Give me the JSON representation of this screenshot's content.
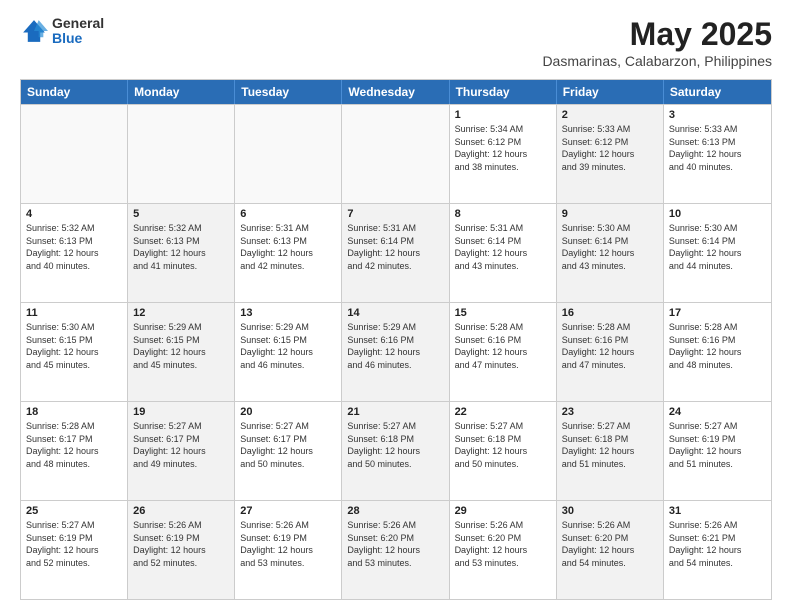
{
  "header": {
    "logo_general": "General",
    "logo_blue": "Blue",
    "month_year": "May 2025",
    "location": "Dasmarinas, Calabarzon, Philippines"
  },
  "weekdays": [
    "Sunday",
    "Monday",
    "Tuesday",
    "Wednesday",
    "Thursday",
    "Friday",
    "Saturday"
  ],
  "weeks": [
    [
      {
        "day": "",
        "info": "",
        "shaded": false,
        "empty": true
      },
      {
        "day": "",
        "info": "",
        "shaded": false,
        "empty": true
      },
      {
        "day": "",
        "info": "",
        "shaded": false,
        "empty": true
      },
      {
        "day": "",
        "info": "",
        "shaded": false,
        "empty": true
      },
      {
        "day": "1",
        "info": "Sunrise: 5:34 AM\nSunset: 6:12 PM\nDaylight: 12 hours\nand 38 minutes.",
        "shaded": false,
        "empty": false
      },
      {
        "day": "2",
        "info": "Sunrise: 5:33 AM\nSunset: 6:12 PM\nDaylight: 12 hours\nand 39 minutes.",
        "shaded": true,
        "empty": false
      },
      {
        "day": "3",
        "info": "Sunrise: 5:33 AM\nSunset: 6:13 PM\nDaylight: 12 hours\nand 40 minutes.",
        "shaded": false,
        "empty": false
      }
    ],
    [
      {
        "day": "4",
        "info": "Sunrise: 5:32 AM\nSunset: 6:13 PM\nDaylight: 12 hours\nand 40 minutes.",
        "shaded": false,
        "empty": false
      },
      {
        "day": "5",
        "info": "Sunrise: 5:32 AM\nSunset: 6:13 PM\nDaylight: 12 hours\nand 41 minutes.",
        "shaded": true,
        "empty": false
      },
      {
        "day": "6",
        "info": "Sunrise: 5:31 AM\nSunset: 6:13 PM\nDaylight: 12 hours\nand 42 minutes.",
        "shaded": false,
        "empty": false
      },
      {
        "day": "7",
        "info": "Sunrise: 5:31 AM\nSunset: 6:14 PM\nDaylight: 12 hours\nand 42 minutes.",
        "shaded": true,
        "empty": false
      },
      {
        "day": "8",
        "info": "Sunrise: 5:31 AM\nSunset: 6:14 PM\nDaylight: 12 hours\nand 43 minutes.",
        "shaded": false,
        "empty": false
      },
      {
        "day": "9",
        "info": "Sunrise: 5:30 AM\nSunset: 6:14 PM\nDaylight: 12 hours\nand 43 minutes.",
        "shaded": true,
        "empty": false
      },
      {
        "day": "10",
        "info": "Sunrise: 5:30 AM\nSunset: 6:14 PM\nDaylight: 12 hours\nand 44 minutes.",
        "shaded": false,
        "empty": false
      }
    ],
    [
      {
        "day": "11",
        "info": "Sunrise: 5:30 AM\nSunset: 6:15 PM\nDaylight: 12 hours\nand 45 minutes.",
        "shaded": false,
        "empty": false
      },
      {
        "day": "12",
        "info": "Sunrise: 5:29 AM\nSunset: 6:15 PM\nDaylight: 12 hours\nand 45 minutes.",
        "shaded": true,
        "empty": false
      },
      {
        "day": "13",
        "info": "Sunrise: 5:29 AM\nSunset: 6:15 PM\nDaylight: 12 hours\nand 46 minutes.",
        "shaded": false,
        "empty": false
      },
      {
        "day": "14",
        "info": "Sunrise: 5:29 AM\nSunset: 6:16 PM\nDaylight: 12 hours\nand 46 minutes.",
        "shaded": true,
        "empty": false
      },
      {
        "day": "15",
        "info": "Sunrise: 5:28 AM\nSunset: 6:16 PM\nDaylight: 12 hours\nand 47 minutes.",
        "shaded": false,
        "empty": false
      },
      {
        "day": "16",
        "info": "Sunrise: 5:28 AM\nSunset: 6:16 PM\nDaylight: 12 hours\nand 47 minutes.",
        "shaded": true,
        "empty": false
      },
      {
        "day": "17",
        "info": "Sunrise: 5:28 AM\nSunset: 6:16 PM\nDaylight: 12 hours\nand 48 minutes.",
        "shaded": false,
        "empty": false
      }
    ],
    [
      {
        "day": "18",
        "info": "Sunrise: 5:28 AM\nSunset: 6:17 PM\nDaylight: 12 hours\nand 48 minutes.",
        "shaded": false,
        "empty": false
      },
      {
        "day": "19",
        "info": "Sunrise: 5:27 AM\nSunset: 6:17 PM\nDaylight: 12 hours\nand 49 minutes.",
        "shaded": true,
        "empty": false
      },
      {
        "day": "20",
        "info": "Sunrise: 5:27 AM\nSunset: 6:17 PM\nDaylight: 12 hours\nand 50 minutes.",
        "shaded": false,
        "empty": false
      },
      {
        "day": "21",
        "info": "Sunrise: 5:27 AM\nSunset: 6:18 PM\nDaylight: 12 hours\nand 50 minutes.",
        "shaded": true,
        "empty": false
      },
      {
        "day": "22",
        "info": "Sunrise: 5:27 AM\nSunset: 6:18 PM\nDaylight: 12 hours\nand 50 minutes.",
        "shaded": false,
        "empty": false
      },
      {
        "day": "23",
        "info": "Sunrise: 5:27 AM\nSunset: 6:18 PM\nDaylight: 12 hours\nand 51 minutes.",
        "shaded": true,
        "empty": false
      },
      {
        "day": "24",
        "info": "Sunrise: 5:27 AM\nSunset: 6:19 PM\nDaylight: 12 hours\nand 51 minutes.",
        "shaded": false,
        "empty": false
      }
    ],
    [
      {
        "day": "25",
        "info": "Sunrise: 5:27 AM\nSunset: 6:19 PM\nDaylight: 12 hours\nand 52 minutes.",
        "shaded": false,
        "empty": false
      },
      {
        "day": "26",
        "info": "Sunrise: 5:26 AM\nSunset: 6:19 PM\nDaylight: 12 hours\nand 52 minutes.",
        "shaded": true,
        "empty": false
      },
      {
        "day": "27",
        "info": "Sunrise: 5:26 AM\nSunset: 6:19 PM\nDaylight: 12 hours\nand 53 minutes.",
        "shaded": false,
        "empty": false
      },
      {
        "day": "28",
        "info": "Sunrise: 5:26 AM\nSunset: 6:20 PM\nDaylight: 12 hours\nand 53 minutes.",
        "shaded": true,
        "empty": false
      },
      {
        "day": "29",
        "info": "Sunrise: 5:26 AM\nSunset: 6:20 PM\nDaylight: 12 hours\nand 53 minutes.",
        "shaded": false,
        "empty": false
      },
      {
        "day": "30",
        "info": "Sunrise: 5:26 AM\nSunset: 6:20 PM\nDaylight: 12 hours\nand 54 minutes.",
        "shaded": true,
        "empty": false
      },
      {
        "day": "31",
        "info": "Sunrise: 5:26 AM\nSunset: 6:21 PM\nDaylight: 12 hours\nand 54 minutes.",
        "shaded": false,
        "empty": false
      }
    ]
  ]
}
